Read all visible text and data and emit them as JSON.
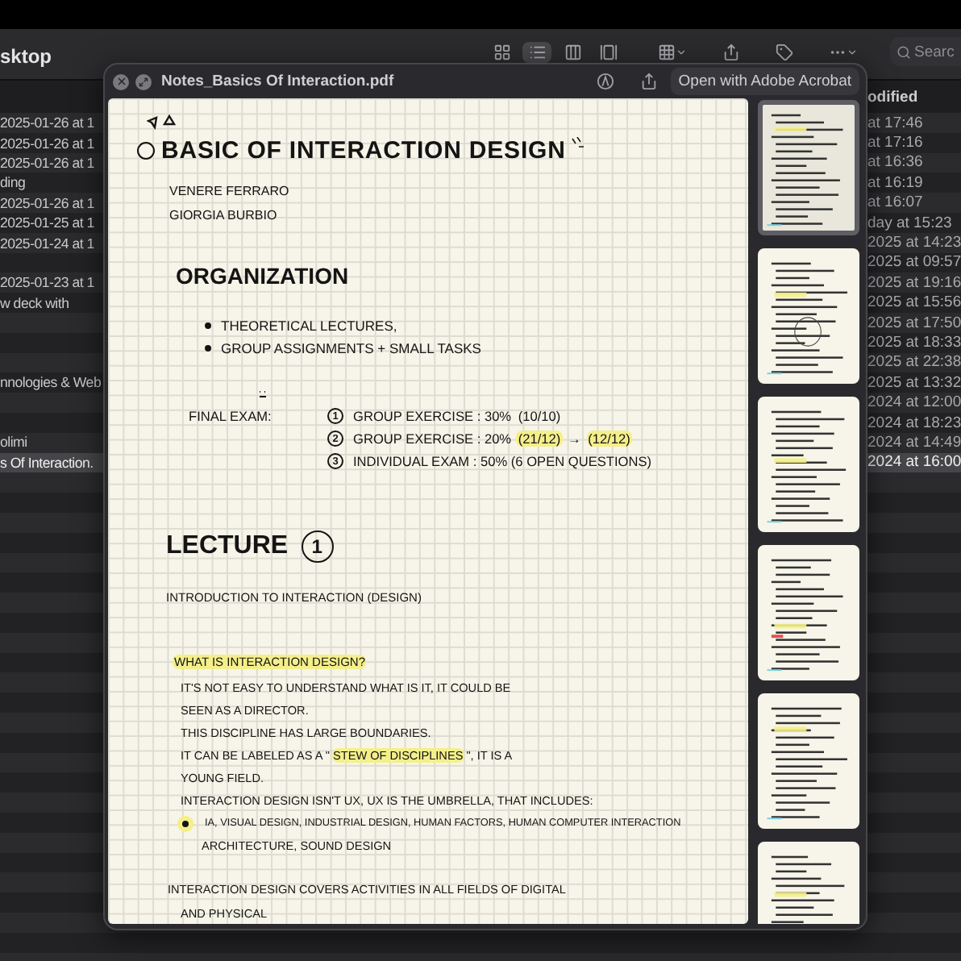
{
  "finder": {
    "title": "sktop",
    "toolbar": {
      "views": [
        {
          "kind": "icons",
          "selected": false
        },
        {
          "kind": "list",
          "selected": true
        },
        {
          "kind": "columns",
          "selected": false
        },
        {
          "kind": "gallery",
          "selected": false
        }
      ],
      "search": {
        "placeholder": "Searc"
      }
    },
    "column_2_header": "odified",
    "rows": [
      {
        "column_1": "2025-01-26 at 1",
        "column_2": "at 17:46",
        "selected": false
      },
      {
        "column_1": "2025-01-26 at 1",
        "column_2": "at 17:16",
        "selected": false
      },
      {
        "column_1": "2025-01-26 at 1",
        "column_2": "at 16:36",
        "selected": false
      },
      {
        "column_1": "ding",
        "column_2": "at 16:19",
        "selected": false
      },
      {
        "column_1": "2025-01-26 at 1",
        "column_2": "at 16:07",
        "selected": false
      },
      {
        "column_1": "2025-01-25 at 1",
        "column_2": "day at 15:23",
        "selected": false
      },
      {
        "column_1": "2025-01-24 at 1",
        "column_2": "2025 at 14:23",
        "selected": false
      },
      {
        "column_2": "2025 at 09:57",
        "selected": false
      },
      {
        "column_1": "2025-01-23 at 1",
        "column_2": "2025 at 19:16",
        "selected": false
      },
      {
        "column_1": "w deck with",
        "column_2": "2025 at 15:56",
        "selected": false
      },
      {
        "column_2": "2025 at 17:50",
        "selected": false
      },
      {
        "column_2": "2025 at 18:33",
        "selected": false
      },
      {
        "column_2": "2025 at 22:38",
        "selected": false
      },
      {
        "column_1": "nnologies & Web",
        "column_2": "2025 at 13:32",
        "selected": false
      },
      {
        "column_2": "2024 at 12:00",
        "selected": false
      },
      {
        "column_2": "2024 at 18:23",
        "selected": false
      },
      {
        "column_1": "olimi",
        "column_2": "2024 at 14:49",
        "selected": false
      },
      {
        "column_1": "s Of Interaction.",
        "column_2": "2024 at 16:00",
        "selected": true
      }
    ]
  },
  "quicklook": {
    "title": "Notes_Basics Of Interaction.pdf",
    "open_button": "Open with Adobe Acrobat",
    "page": {
      "lines": [
        {
          "kind": "doodle"
        },
        {
          "kind": "title",
          "text": "BASIC OF INTERACTION DESIGN"
        },
        {
          "kind": "name",
          "text": "VENERE FERRARO"
        },
        {
          "kind": "name",
          "text": "GIORGIA BURBIO"
        },
        {
          "kind": "heading",
          "text": "ORGANIZATION"
        },
        {
          "kind": "bullet",
          "text": "THEORETICAL LECTURES,"
        },
        {
          "kind": "bullet",
          "text": "GROUP ASSIGNMENTS + SMALL TASKS"
        },
        {
          "kind": "exam",
          "label": "FINAL EXAM:",
          "items": [
            {
              "marker": "1",
              "parts": [
                {
                  "text": "GROUP EXERCISE : 30% ",
                  "highlight": false
                },
                {
                  "text": "(10/10)",
                  "highlight": false
                }
              ]
            },
            {
              "marker": "2",
              "parts": [
                {
                  "text": "GROUP EXERCISE : 20% ",
                  "highlight": false
                },
                {
                  "text": "(21/12)",
                  "highlight": true
                },
                {
                  "text": " → ",
                  "highlight": false
                },
                {
                  "text": "(12/12)",
                  "highlight": true
                }
              ]
            },
            {
              "marker": "3",
              "parts": [
                {
                  "text": "INDIVIDUAL EXAM : 50% (6 OPEN QUESTIONS)",
                  "highlight": false
                }
              ]
            }
          ]
        },
        {
          "kind": "lecture",
          "text": "LECTURE",
          "number": "1"
        },
        {
          "kind": "subtitle",
          "text": "INTRODUCTION TO INTERACTION (DESIGN)"
        },
        {
          "kind": "question",
          "parts": [
            {
              "text": "WHAT IS INTERACTION DESIGN?",
              "highlight": true
            }
          ]
        },
        {
          "kind": "text",
          "parts": [
            {
              "text": "IT'S NOT EASY TO UNDERSTAND WHAT IS IT, IT COULD BE",
              "highlight": false
            }
          ]
        },
        {
          "kind": "text",
          "parts": [
            {
              "text": "SEEN AS A DIRECTOR.",
              "highlight": false
            }
          ]
        },
        {
          "kind": "text",
          "parts": [
            {
              "text": "THIS DISCIPLINE HAS LARGE BOUNDARIES.",
              "highlight": false
            }
          ]
        },
        {
          "kind": "text",
          "parts": [
            {
              "text": "IT CAN BE LABELED AS A \"",
              "highlight": false
            },
            {
              "text": "STEW OF DISCIPLINES",
              "highlight": true
            },
            {
              "text": "\", IT IS A",
              "highlight": false
            }
          ]
        },
        {
          "kind": "text",
          "parts": [
            {
              "text": "YOUNG FIELD.",
              "highlight": false
            }
          ]
        },
        {
          "kind": "text",
          "parts": [
            {
              "text": "INTERACTION DESIGN ISN'T UX, UX IS THE UMBRELLA, THAT INCLUDES:",
              "highlight": false
            }
          ]
        },
        {
          "kind": "point",
          "highlight": true,
          "parts": [
            {
              "text": "IA, VISUAL DESIGN, INDUSTRIAL DESIGN, HUMAN FACTORS, HUMAN COMPUTER INTERACTION",
              "highlight": false
            }
          ]
        },
        {
          "kind": "continuation",
          "parts": [
            {
              "text": "ARCHITECTURE, SOUND DESIGN",
              "highlight": false
            }
          ]
        },
        {
          "kind": "paragraph",
          "parts": [
            {
              "text": "INTERACTION DESIGN COVERS ACTIVITIES IN ALL FIELDS OF DIGITAL",
              "highlight": false
            }
          ]
        },
        {
          "kind": "text",
          "parts": [
            {
              "text": "AND PHYSICAL",
              "highlight": false
            }
          ]
        }
      ]
    },
    "thumbnails": [
      {
        "selected": true
      },
      {
        "selected": false
      },
      {
        "selected": false
      },
      {
        "selected": false
      },
      {
        "selected": false
      },
      {
        "selected": false
      }
    ]
  }
}
